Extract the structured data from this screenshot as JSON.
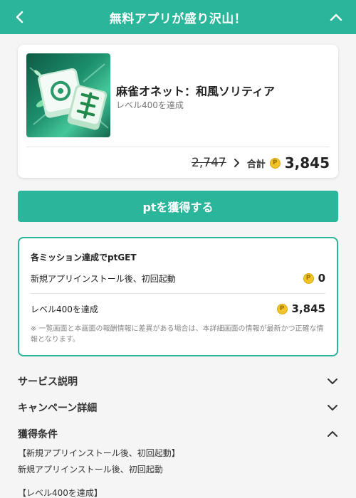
{
  "header": {
    "title": "無料アプリが盛り沢山！"
  },
  "app": {
    "title": "麻雀オネット：和風ソリティア",
    "subtitle": "レベル400を達成",
    "old_points": "2,747",
    "total_label": "合計",
    "coin_glyph": "P",
    "total_points": "3,845"
  },
  "cta": {
    "label": "ptを獲得する"
  },
  "mission": {
    "heading": "各ミッション達成でptGET",
    "rows": [
      {
        "label": "新規アプリインストール後、初回起動",
        "points": "0"
      },
      {
        "label": "レベル400を達成",
        "points": "3,845"
      }
    ],
    "note": "※ 一覧画面と本画面の報酬情報に差異がある場合は、本詳細画面の情報が最新かつ正確な情報となります。"
  },
  "sections": [
    {
      "label": "サービス説明",
      "state": "collapsed"
    },
    {
      "label": "キャンペーン詳細",
      "state": "collapsed"
    },
    {
      "label": "獲得条件",
      "state": "expanded"
    }
  ],
  "conditions": {
    "line1": "【新規アプリインストール後、初回起動】",
    "line2": "新規アプリインストール後、初回起動",
    "line3": "【レベル400を達成】"
  },
  "colors": {
    "accent": "#2bb59a",
    "coin": "#f2c42a"
  }
}
